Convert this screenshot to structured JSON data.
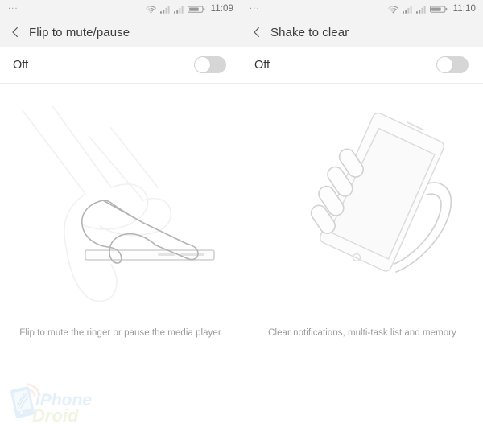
{
  "screens": [
    {
      "statusbar": {
        "overflow": "...",
        "icons": [
          "wifi-icon",
          "signal-icon",
          "signal-icon",
          "battery-icon"
        ],
        "time": "11:09"
      },
      "appbar": {
        "back_icon": "chevron-left-icon",
        "title": "Flip to mute/pause"
      },
      "toggle": {
        "label": "Off",
        "state": "off"
      },
      "illustration": "hand-flipping-phone-facedown-illustration",
      "caption": "Flip to mute the ringer or pause the media player"
    },
    {
      "statusbar": {
        "overflow": "...",
        "icons": [
          "wifi-icon",
          "signal-icon",
          "signal-icon",
          "battery-icon"
        ],
        "time": "11:10"
      },
      "appbar": {
        "back_icon": "chevron-left-icon",
        "title": "Shake to clear"
      },
      "toggle": {
        "label": "Off",
        "state": "off"
      },
      "illustration": "hand-holding-phone-shaking-illustration",
      "caption": "Clear notifications, multi-task list and memory"
    }
  ],
  "watermark": {
    "line1": "iPhone",
    "line2": "Droid",
    "icon": "smartphone-icon",
    "color_line1": "#e4f0f9",
    "color_line2": "#eff4e3"
  },
  "colors": {
    "statusbar_bg": "#f3f3f3",
    "appbar_bg": "#f3f3f3",
    "page_bg": "#ffffff",
    "title_text": "#3c3c3c",
    "caption_text": "#9b9b9b",
    "switch_track_off": "#d6d6d6",
    "switch_knob": "#ffffff",
    "divider": "#ededed",
    "illustration_stroke": "#b9b9b9"
  }
}
